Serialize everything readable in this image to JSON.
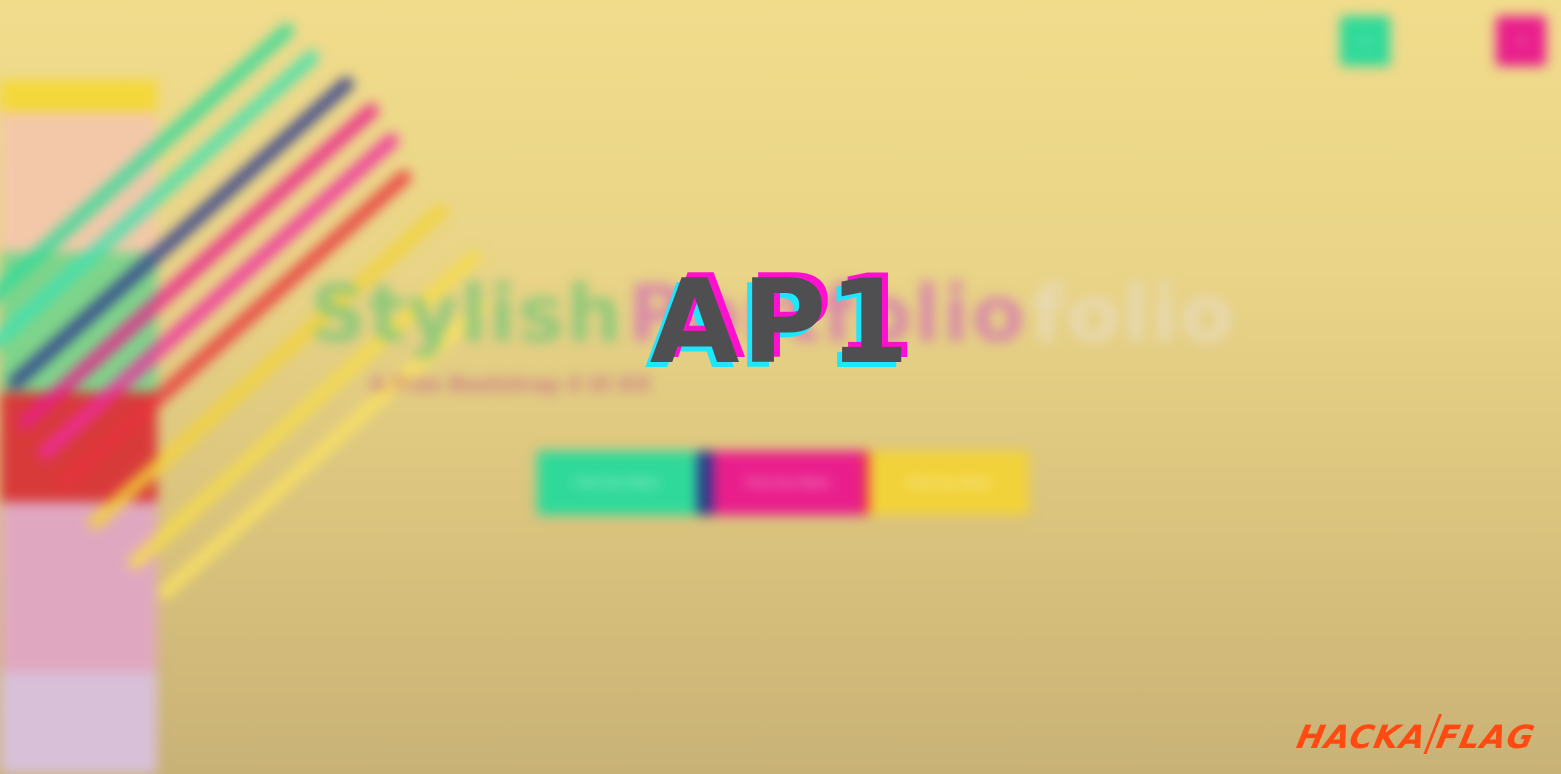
{
  "overlay": {
    "label": "AP1"
  },
  "background": {
    "title_parts": [
      "Stylish",
      "Portfolio",
      "folio"
    ],
    "subtitle": "A Free Bootstrap 4 UI Kit",
    "buttons": [
      "Find Out More",
      "Find Out More",
      "Find Out More"
    ],
    "corner_buttons": [
      "≡",
      "≡"
    ]
  },
  "logo": {
    "left": "HACKA",
    "right": "FLAG"
  },
  "colors": {
    "green": "#2fd99a",
    "pink": "#e91e8c",
    "yellow": "#f2d23a",
    "navy": "#2b3a8c",
    "red": "#e8343c",
    "label": "#4f4f51",
    "logo": "#ff4a12"
  }
}
